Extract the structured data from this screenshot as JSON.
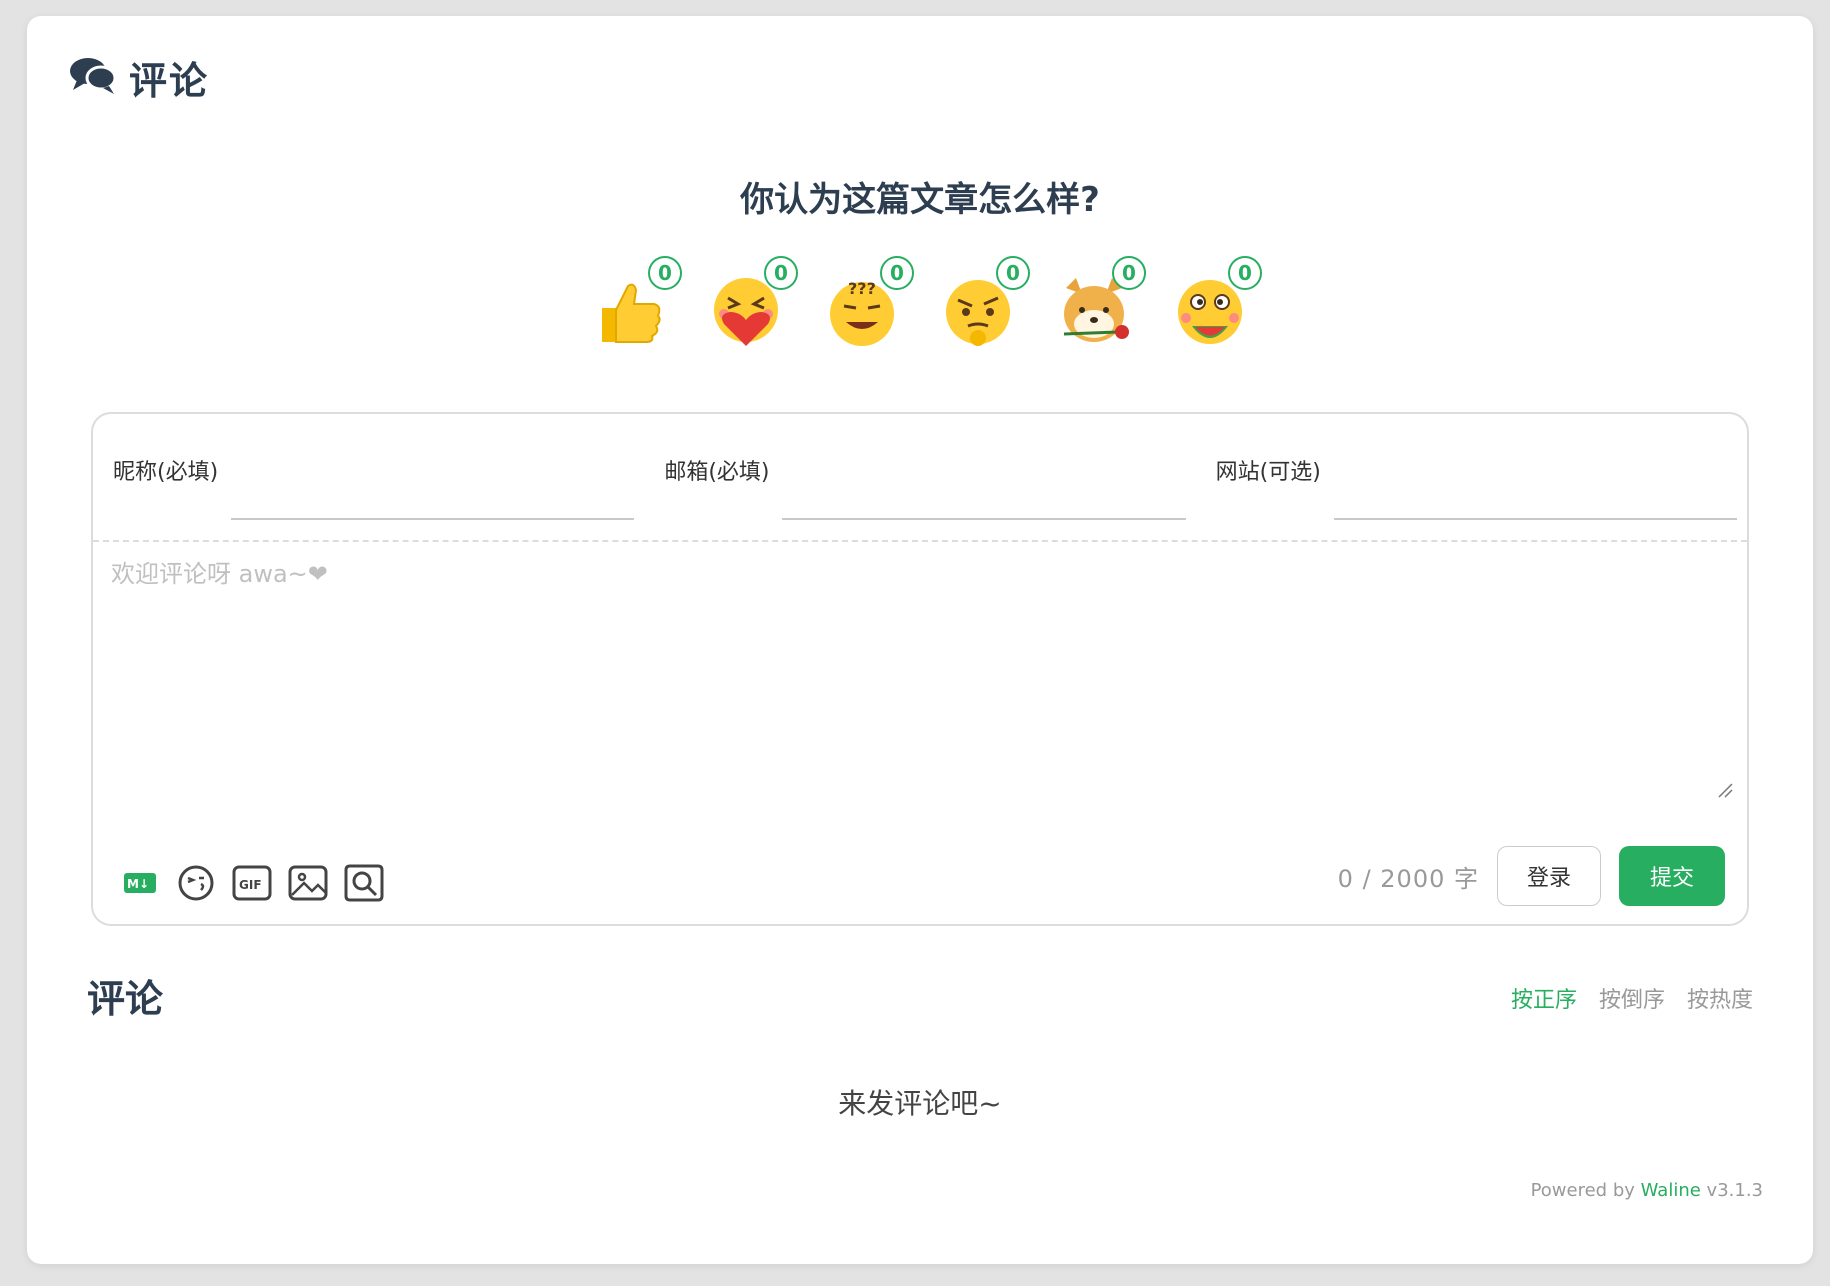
{
  "header": {
    "title": "评论",
    "icon": "comments-icon"
  },
  "reaction": {
    "title": "你认为这篇文章怎么样?",
    "items": [
      {
        "emoji": "thumbs-up",
        "count": "0"
      },
      {
        "emoji": "heart-hug",
        "count": "0"
      },
      {
        "emoji": "dizzy-grin",
        "count": "0"
      },
      {
        "emoji": "skeptical",
        "count": "0"
      },
      {
        "emoji": "doge-rose",
        "count": "0"
      },
      {
        "emoji": "watermelon-eater",
        "count": "0"
      }
    ]
  },
  "form": {
    "nick_label": "昵称(必填)",
    "mail_label": "邮箱(必填)",
    "link_label": "网站(可选)",
    "editor_placeholder": "欢迎评论呀 awa~❤",
    "counter_text": "0 / 2000 字",
    "login_label": "登录",
    "submit_label": "提交"
  },
  "toolbar": {
    "icons": [
      "markdown-icon",
      "emoji-icon",
      "gif-icon",
      "image-icon",
      "preview-icon"
    ]
  },
  "comments": {
    "title": "评论",
    "sort": [
      "按正序",
      "按倒序",
      "按热度"
    ],
    "active_sort": "按正序",
    "empty_text": "来发评论吧~"
  },
  "footer": {
    "powered_prefix": "Powered by",
    "powered_link": "Waline",
    "version": "v3.1.3"
  },
  "colors": {
    "accent": "#27ae60",
    "title": "#2c3e50",
    "muted": "#999999"
  }
}
